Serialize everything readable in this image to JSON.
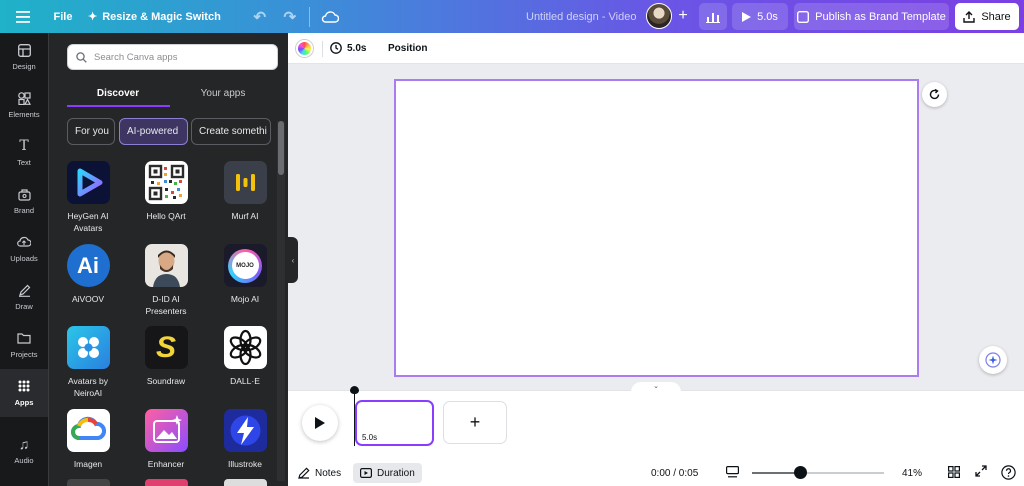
{
  "topbar": {
    "file_label": "File",
    "resize_label": "Resize & Magic Switch",
    "doc_title": "Untitled design - Video",
    "play_duration": "5.0s",
    "publish_label": "Publish as Brand Template",
    "share_label": "Share"
  },
  "rail": {
    "items": [
      {
        "label": "Design",
        "icon": "layout-icon"
      },
      {
        "label": "Elements",
        "icon": "shapes-icon"
      },
      {
        "label": "Text",
        "icon": "text-icon"
      },
      {
        "label": "Brand",
        "icon": "brand-icon"
      },
      {
        "label": "Uploads",
        "icon": "upload-icon"
      },
      {
        "label": "Draw",
        "icon": "draw-icon"
      },
      {
        "label": "Projects",
        "icon": "folder-icon"
      },
      {
        "label": "Apps",
        "icon": "apps-grid-icon"
      },
      {
        "label": "Audio",
        "icon": "music-icon"
      }
    ],
    "active": "Apps"
  },
  "panel": {
    "search_placeholder": "Search Canva apps",
    "tabs": [
      {
        "label": "Discover"
      },
      {
        "label": "Your apps"
      }
    ],
    "chips": [
      {
        "label": "For you"
      },
      {
        "label": "AI-powered"
      },
      {
        "label": "Create somethi"
      }
    ],
    "apps": [
      {
        "label": "HeyGen AI Avatars"
      },
      {
        "label": "Hello QArt"
      },
      {
        "label": "Murf AI"
      },
      {
        "label": "AiVOOV"
      },
      {
        "label": "D-ID AI Presenters"
      },
      {
        "label": "Mojo AI"
      },
      {
        "label": "Avatars by NeiroAI"
      },
      {
        "label": "Soundraw"
      },
      {
        "label": "DALL·E"
      },
      {
        "label": "Imagen"
      },
      {
        "label": "Enhancer"
      },
      {
        "label": "Illustroke"
      }
    ],
    "tile_text": {
      "aivoov": "Ai",
      "mojo": "MOJO",
      "soundraw": "S"
    }
  },
  "context_bar": {
    "duration": "5.0s",
    "position_label": "Position"
  },
  "timeline": {
    "clip_duration": "5.0s",
    "add_label": "+"
  },
  "footer": {
    "notes_label": "Notes",
    "duration_label": "Duration",
    "time": "0:00 / 0:05",
    "zoom_percent": "41%",
    "zoom_fraction": 0.37
  }
}
